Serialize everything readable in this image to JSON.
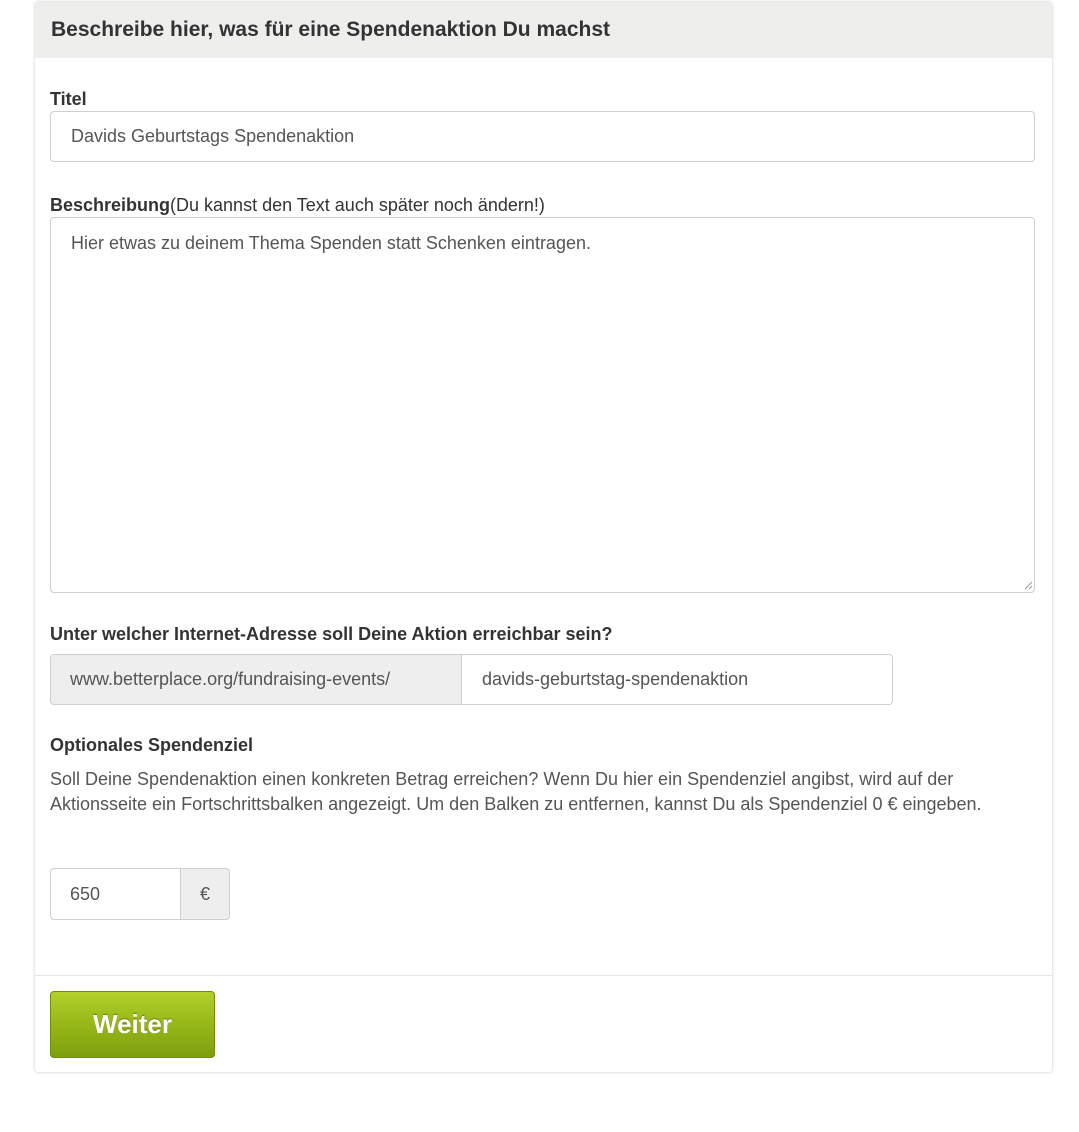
{
  "header": {
    "title": "Beschreibe hier, was für eine Spendenaktion Du machst"
  },
  "title_field": {
    "label": "Titel",
    "value": "Davids Geburtstags Spendenaktion"
  },
  "description_field": {
    "label": "Beschreibung",
    "hint": "(Du kannst den Text auch später noch ändern!)",
    "value": "Hier etwas zu deinem Thema Spenden statt Schenken eintragen."
  },
  "url_field": {
    "label": "Unter welcher Internet-Adresse soll Deine Aktion erreichbar sein?",
    "prefix": "www.betterplace.org/fundraising-events/",
    "value": "davids-geburtstag-spendenaktion"
  },
  "goal_field": {
    "label": "Optionales Spendenziel",
    "help": "Soll Deine Spendenaktion einen konkreten Betrag erreichen? Wenn Du hier ein Spendenziel angibst, wird auf der Aktionsseite ein Fortschrittsbalken angezeigt. Um den Balken zu entfernen, kannst Du als Spendenziel 0 € eingeben.",
    "value": "650",
    "currency": "€"
  },
  "footer": {
    "next_label": "Weiter"
  },
  "colors": {
    "header_bg": "#eeeeec",
    "button_green": "#93b516",
    "addon_bg": "#eeeeee"
  }
}
